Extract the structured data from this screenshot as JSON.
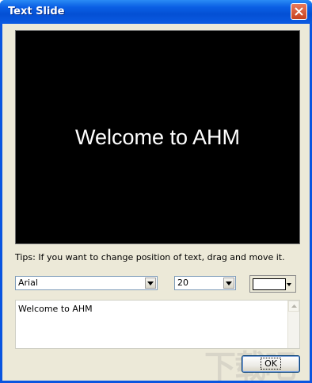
{
  "window": {
    "title": "Text Slide"
  },
  "preview": {
    "text": "Welcome to AHM"
  },
  "tips": {
    "text": "Tips: If you want to change position of text, drag and move it."
  },
  "font_select": {
    "value": "Arial"
  },
  "size_select": {
    "value": "20"
  },
  "color_picker": {
    "color": "#ffffff"
  },
  "text_input": {
    "value": "Welcome to AHM"
  },
  "buttons": {
    "ok": "OK"
  },
  "watermark": {
    "text": "下载吧"
  },
  "icons": {
    "close": "close-icon",
    "dropdown": "chevron-down-icon",
    "scroll_up": "arrow-up-icon"
  }
}
